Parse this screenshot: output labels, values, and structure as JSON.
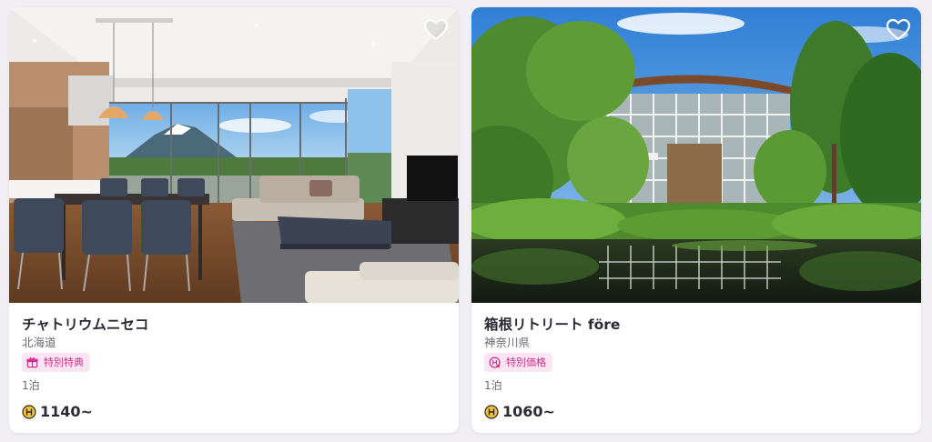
{
  "colors": {
    "accent_pink": "#d02d8c",
    "badge_bg": "#fce6f3",
    "coin_yellow": "#f2c230",
    "text_primary": "#2b2a37",
    "text_secondary": "#6b6a75"
  },
  "listings": [
    {
      "title": "チャトリウムニセコ",
      "region": "北海道",
      "badge_icon": "gift-icon",
      "badge_label": "特別特典",
      "nights": "1泊",
      "price_icon": "coin-icon",
      "price": "1140~",
      "favorite_icon": "heart-outline-icon",
      "photo_description": "villa-living-room-mount-yotei-view"
    },
    {
      "title": "箱根リトリート före",
      "region": "神奈川県",
      "badge_icon": "coin-tag-icon",
      "badge_label": "特別価格",
      "nights": "1泊",
      "price_icon": "coin-icon",
      "price": "1060~",
      "favorite_icon": "heart-outline-icon",
      "photo_description": "forest-retreat-building-with-pond"
    }
  ]
}
